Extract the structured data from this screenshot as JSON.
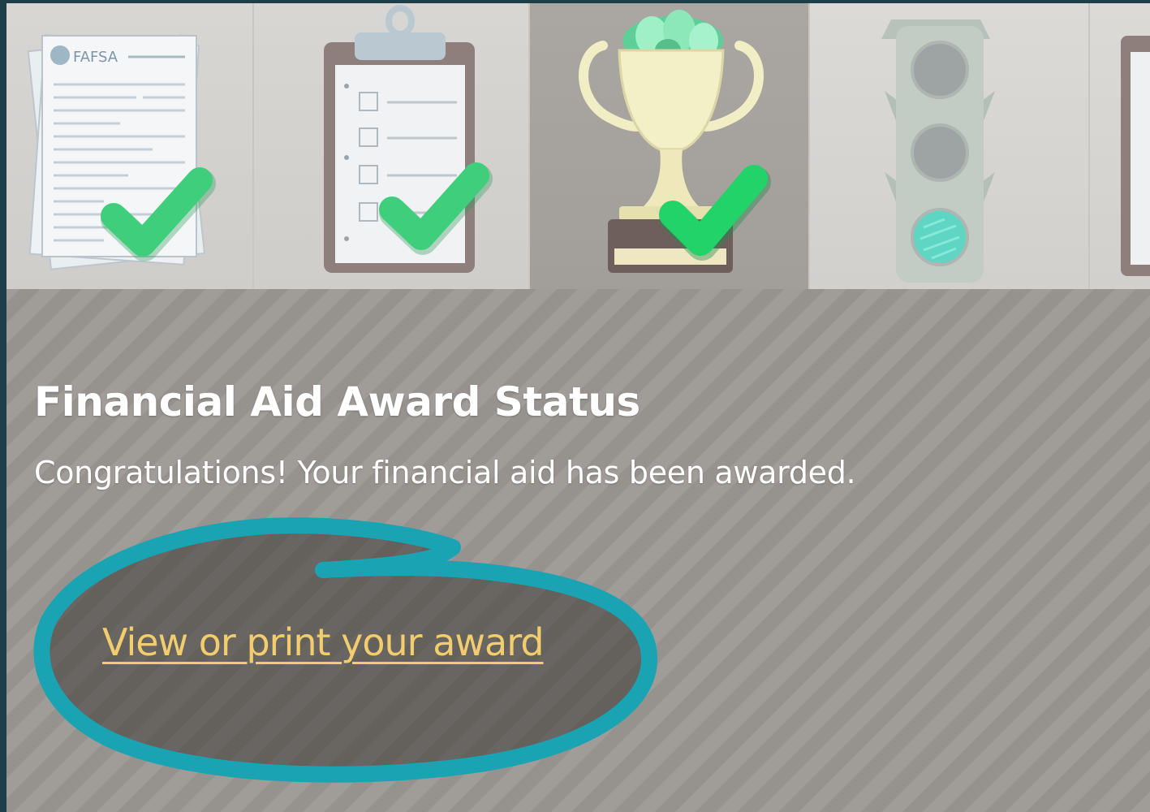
{
  "steps": [
    {
      "icon": "faFSA-form-icon",
      "status": "complete",
      "form_heading": "FAFSA"
    },
    {
      "icon": "clipboard-checklist-icon",
      "status": "complete"
    },
    {
      "icon": "trophy-icon",
      "status": "complete",
      "current": true
    },
    {
      "icon": "traffic-light-icon",
      "status": "pending"
    },
    {
      "icon": "document-icon",
      "status": "pending"
    }
  ],
  "status_panel": {
    "title": "Financial Aid Award Status",
    "message": "Congratulations! Your financial aid has been awarded.",
    "link_label": "View or print your award"
  },
  "colors": {
    "check": "#3fcf7c",
    "link": "#f1cd6e",
    "highlight_ring": "#1aa3b3",
    "panel": "#9c9894"
  }
}
